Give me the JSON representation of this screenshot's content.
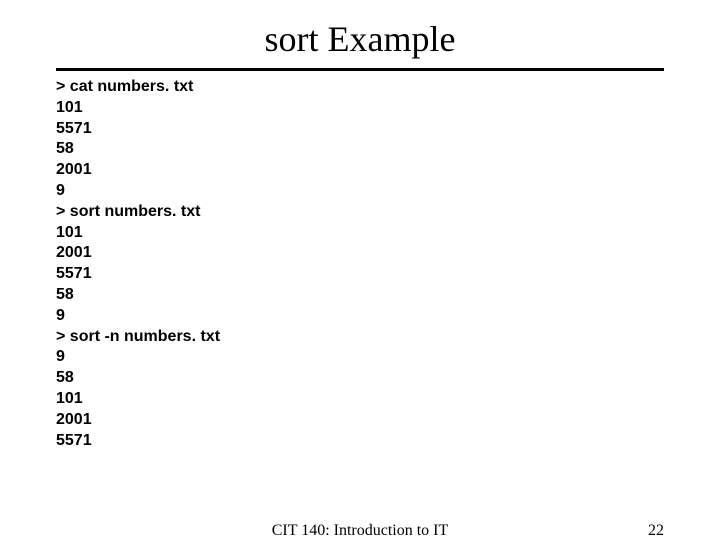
{
  "title": "sort Example",
  "body": "> cat numbers. txt\n101\n5571\n58\n2001\n9\n> sort numbers. txt\n101\n2001\n5571\n58\n9\n> sort -n numbers. txt\n9\n58\n101\n2001\n5571",
  "footer": {
    "center": "CIT 140: Introduction to IT",
    "page": "22"
  }
}
